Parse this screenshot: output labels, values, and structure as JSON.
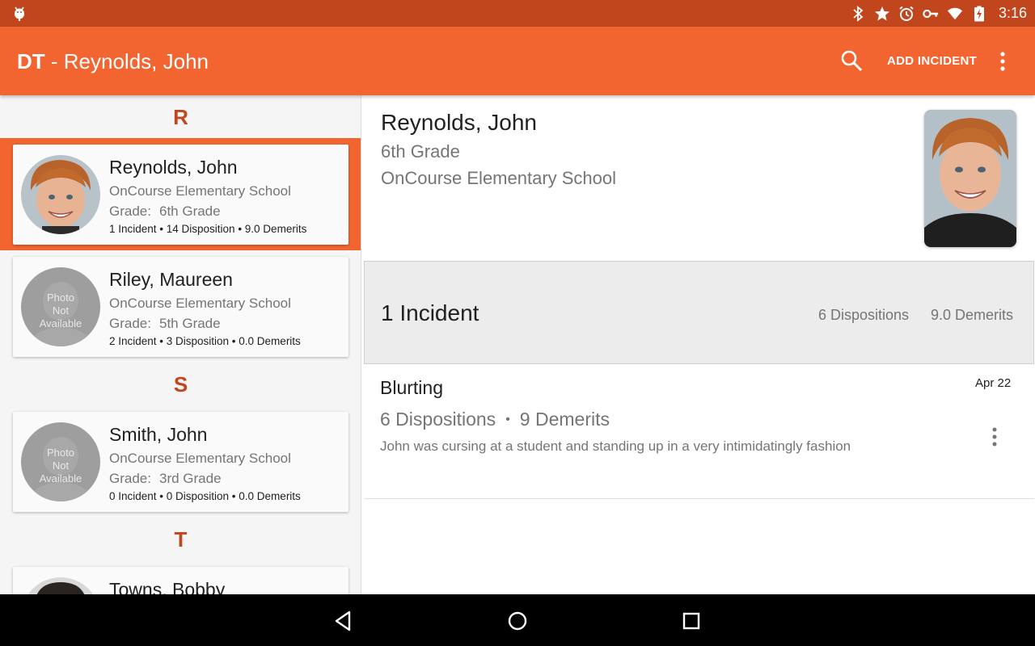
{
  "status_bar": {
    "time": "3:16",
    "icons": [
      "android-debug-icon",
      "bluetooth-icon",
      "star-icon",
      "alarm-icon",
      "vpn-key-icon",
      "wifi-icon",
      "battery-charging-icon"
    ]
  },
  "app_bar": {
    "title_abbr": "DT",
    "title_rest": " - Reynolds, John",
    "add_incident_label": "ADD INCIDENT",
    "background_color": "#f26430",
    "status_color": "#c1461d"
  },
  "student_list": {
    "sections": [
      {
        "letter": "R"
      },
      {
        "letter": "S"
      },
      {
        "letter": "T"
      }
    ],
    "photo_not_available": [
      "Photo",
      "Not",
      "Available"
    ],
    "grade_label": "Grade:",
    "students": [
      {
        "name": "Reynolds, John",
        "school": "OnCourse Elementary School",
        "grade": "6th Grade",
        "summary": "1 Incident • 14 Disposition • 9.0 Demerits",
        "selected": true,
        "has_photo": true
      },
      {
        "name": "Riley, Maureen",
        "school": "OnCourse Elementary School",
        "grade": "5th Grade",
        "summary": "2 Incident • 3 Disposition • 0.0 Demerits",
        "selected": false,
        "has_photo": false
      },
      {
        "name": "Smith, John",
        "school": "OnCourse Elementary School",
        "grade": "3rd Grade",
        "summary": "0 Incident • 0 Disposition • 0.0 Demerits",
        "selected": false,
        "has_photo": false
      },
      {
        "name": "Towns, Bobby",
        "selected": false,
        "has_photo": true
      }
    ]
  },
  "detail": {
    "name": "Reynolds, John",
    "grade": "6th Grade",
    "school": "OnCourse Elementary School",
    "summary": {
      "incident_count": "1  Incident",
      "dispositions": "6 Dispositions",
      "demerits": "9.0 Demerits"
    },
    "incidents": [
      {
        "title": "Blurting",
        "date": "Apr 22",
        "dispositions": "6 Dispositions",
        "separator": "•",
        "demerits": "9 Demerits",
        "description": "John was cursing at a student and standing up in a very intimidatingly fashion"
      }
    ]
  }
}
